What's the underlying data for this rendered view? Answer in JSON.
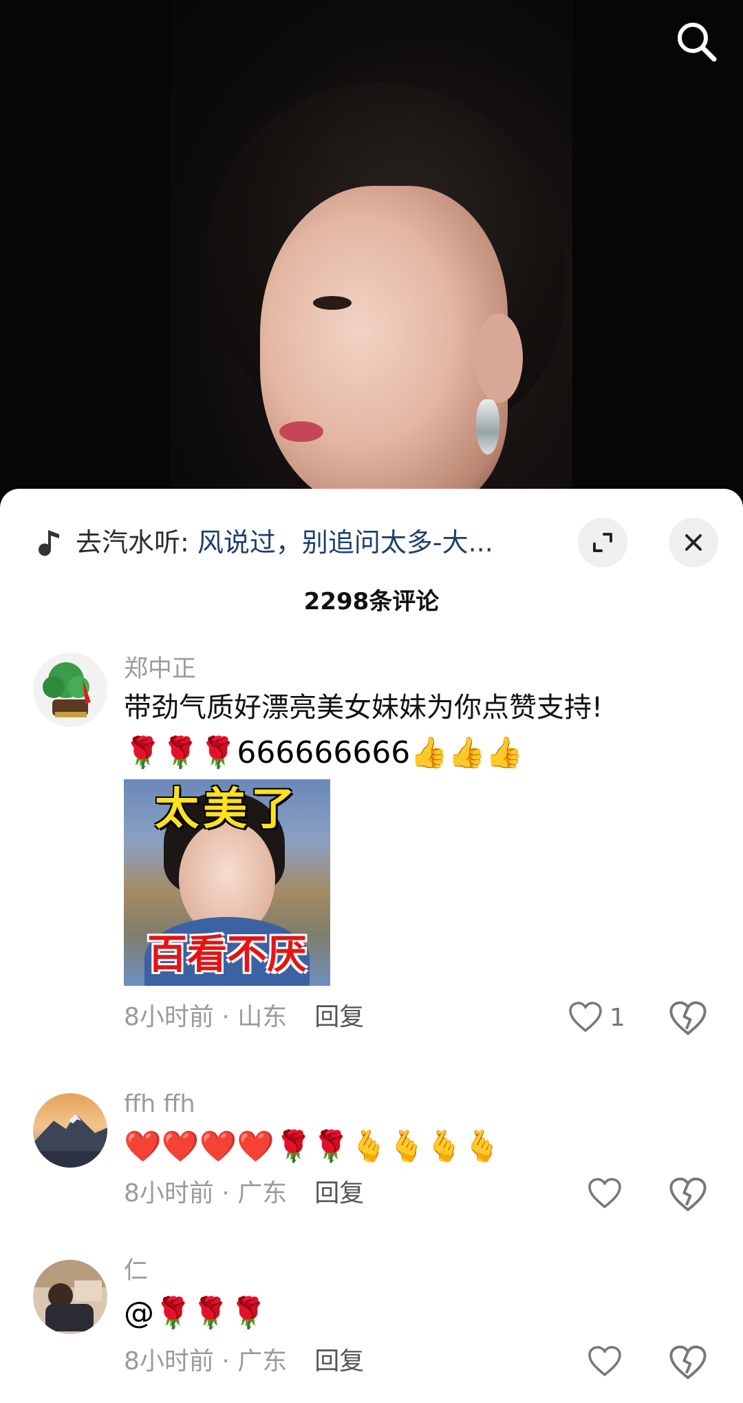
{
  "video": {
    "search_icon": "search-icon"
  },
  "music_bar": {
    "prefix": "去汽水听: ",
    "song_title": "风说过，别追问太多-大...",
    "icon": "music-note-icon",
    "expand_icon": "expand-icon",
    "close_icon": "close-icon"
  },
  "comment_count": "2298条评论",
  "comments": [
    {
      "username": "郑中正",
      "text": "带劲气质好漂亮美女妹妹为你点赞支持!",
      "emojis": "🌹🌹🌹666666666👍👍👍",
      "sticker": {
        "top_text": "太美了",
        "bottom_text": "百看不厌"
      },
      "time": "8小时前",
      "location": "山东",
      "reply_label": "回复",
      "likes": "1"
    },
    {
      "username": "ffh ffh",
      "text": "",
      "emojis": "❤️❤️❤️❤️🌹🌹🫰🫰🫰🫰",
      "time": "8小时前",
      "location": "广东",
      "reply_label": "回复",
      "likes": ""
    },
    {
      "username": "仁",
      "text": "",
      "emojis": "@🌹🌹🌹",
      "time": "8小时前",
      "location": "广东",
      "reply_label": "回复",
      "likes": ""
    }
  ],
  "separator": " · "
}
